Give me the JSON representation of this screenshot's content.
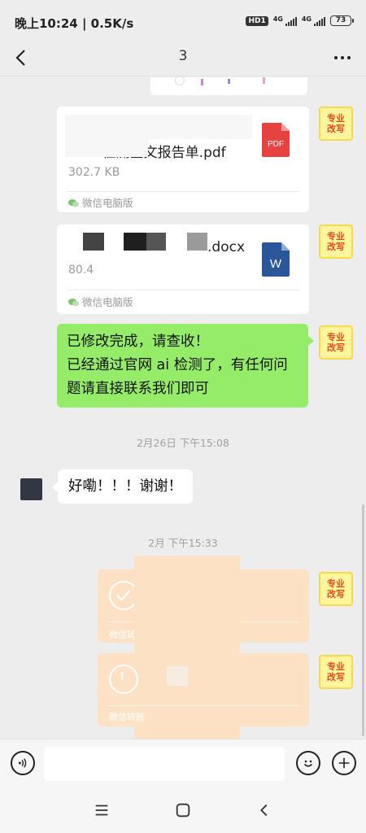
{
  "status_bar": {
    "time": "晚上10:24 | 0.5K/s",
    "hd_label": "HD1",
    "net_label_1": "4G",
    "net_label_2": "4G",
    "battery": "73"
  },
  "nav": {
    "title": "3",
    "back_icon": "chevron-left-icon",
    "more_icon": "more-dots-icon"
  },
  "avatars": {
    "me_label": "专业\n改写"
  },
  "messages": {
    "file1": {
      "name": "AIGC检测全文报告单.pdf",
      "size": "302.7 KB",
      "source": "微信电脑版",
      "icon_label": "PDF"
    },
    "file2": {
      "name": ".docx",
      "size": "80.4",
      "source": "微信电脑版",
      "icon_label": "W"
    },
    "text_sent": "已修改完成，请查收！\n已经通过官网 ai 检测了，有任何问\n题请直接联系我们即可",
    "timestamp1": "2月26日 下午15:08",
    "text_received": "好嘞！！！谢谢！",
    "timestamp2": "2月  下午15:33",
    "transfer1_label": "微信转",
    "transfer2_label": "微信转账"
  },
  "input_bar": {
    "placeholder": ""
  },
  "colors": {
    "bubble_sent": "#95ec69",
    "transfer": "#fce1c5",
    "background": "#ededed",
    "pdf_red": "#e64340",
    "word_blue": "#2b579a"
  }
}
